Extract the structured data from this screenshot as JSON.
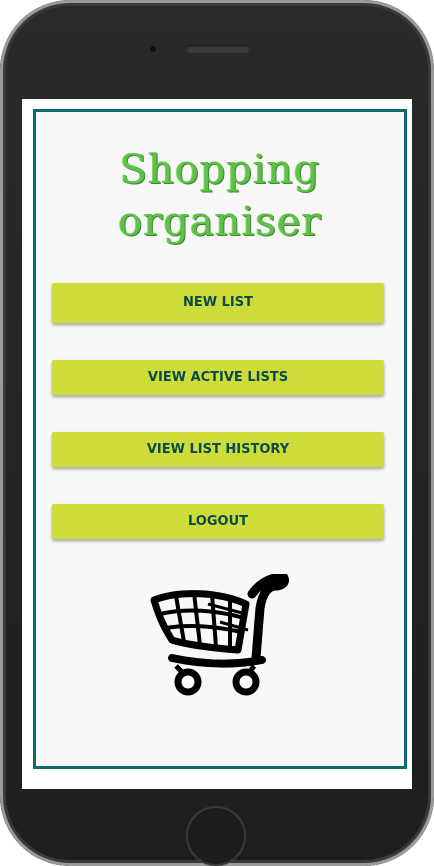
{
  "app": {
    "title_line1": "Shopping",
    "title_line2": "organiser"
  },
  "menu": {
    "new_list": "NEW LIST",
    "view_active_lists": "VIEW ACTIVE LISTS",
    "view_list_history": "VIEW LIST HISTORY",
    "logout": "LOGOUT"
  },
  "icons": {
    "logo": "shopping-cart-icon"
  },
  "colors": {
    "accent": "#cddc39",
    "border": "#0e6a6a",
    "title": "#5fc04a",
    "button_text": "#0a4a4a"
  }
}
